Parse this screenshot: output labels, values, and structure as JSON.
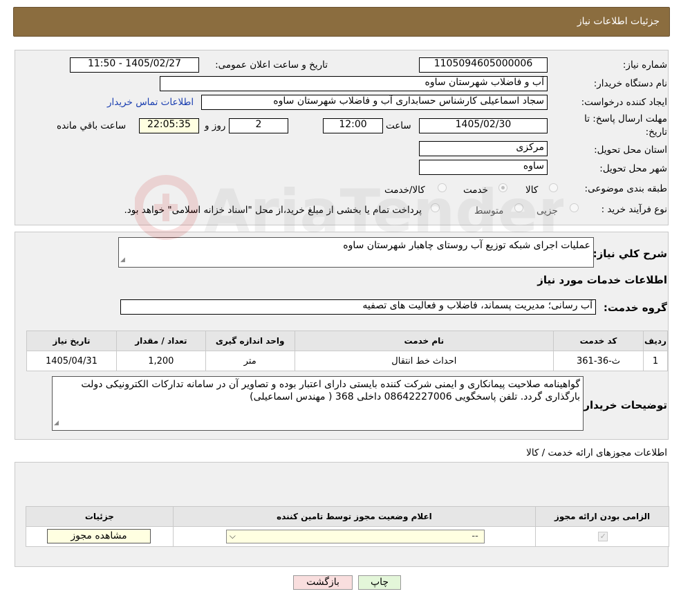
{
  "header": {
    "title": "جزئیات اطلاعات نیاز"
  },
  "form": {
    "need_number_label": "شماره نیاز:",
    "need_number": "1105094605000006",
    "announce_label": "تاریخ و ساعت اعلان عمومی:",
    "announce_value": "1405/02/27 - 11:50",
    "buyer_org_label": "نام دستگاه خریدار:",
    "buyer_org": "آب و فاضلاب شهرستان ساوه",
    "requester_label": "ایجاد کننده درخواست:",
    "requester": "سجاد اسماعیلی کارشناس حسابداری آب و فاضلاب شهرستان ساوه",
    "contact_link": "اطلاعات تماس خریدار",
    "deadline_label_1": "مهلت ارسال پاسخ: تا",
    "deadline_label_2": "تاریخ:",
    "deadline_date": "1405/02/30",
    "time_label": "ساعت",
    "deadline_time": "12:00",
    "days_value": "2",
    "days_label": "روز و",
    "remaining_time": "22:05:35",
    "remaining_label": "ساعت باقي مانده",
    "province_label": "استان محل تحویل:",
    "province": "مرکزی",
    "city_label": "شهر محل تحویل:",
    "city": "ساوه",
    "category_label": "طبقه بندی موضوعی:",
    "category_options": [
      "کالا",
      "خدمت",
      "کالا/خدمت"
    ],
    "category_selected": "خدمت",
    "process_label": "نوع فرآیند خرید :",
    "process_options": [
      "جزیی",
      "متوسط"
    ],
    "process_note": "پرداخت تمام یا بخشی از مبلغ خرید،از محل \"اسناد خزانه اسلامی\" خواهد بود."
  },
  "description": {
    "general_label": "شرح کلي نياز:",
    "general_text": "عملیات اجرای شبکه توزیع آب روستای چاهبار شهرستان ساوه",
    "services_title": "اطلاعات خدمات مورد نیاز",
    "group_label": "گروه خدمت:",
    "group_value": "آب رسانی؛ مدیریت پسماند، فاضلاب و فعالیت های تصفیه"
  },
  "services_table": {
    "headers": [
      "ردیف",
      "کد خدمت",
      "نام خدمت",
      "واحد اندازه گیری",
      "تعداد / مقدار",
      "تاریخ نیاز"
    ],
    "rows": [
      [
        "1",
        "ث-36-361",
        "احداث خط انتقال",
        "متر",
        "1,200",
        "1405/04/31"
      ]
    ]
  },
  "buyer_notes": {
    "label": "توضیحات خریدار:",
    "text": "گواهینامه صلاحیت پیمانکاری و ایمنی شرکت کننده بایستی دارای اعتبار بوده و تصاویر آن در سامانه تدارکات الکترونیکی دولت بارگذاری گردد. تلفن پاسخگویی 08642227006 داخلی 368 ( مهندس اسماعیلی)"
  },
  "permits": {
    "title": "اطلاعات مجوزهای ارائه خدمت / کالا",
    "headers": [
      "الزامی بودن ارائه مجوز",
      "اعلام وضعیت مجوز توسط تامین کننده",
      "جزئیات"
    ],
    "select_value": "--",
    "view_button": "مشاهده مجوز"
  },
  "buttons": {
    "print": "چاپ",
    "back": "بازگشت"
  },
  "watermark": {
    "text": "AriaTender.neT"
  }
}
